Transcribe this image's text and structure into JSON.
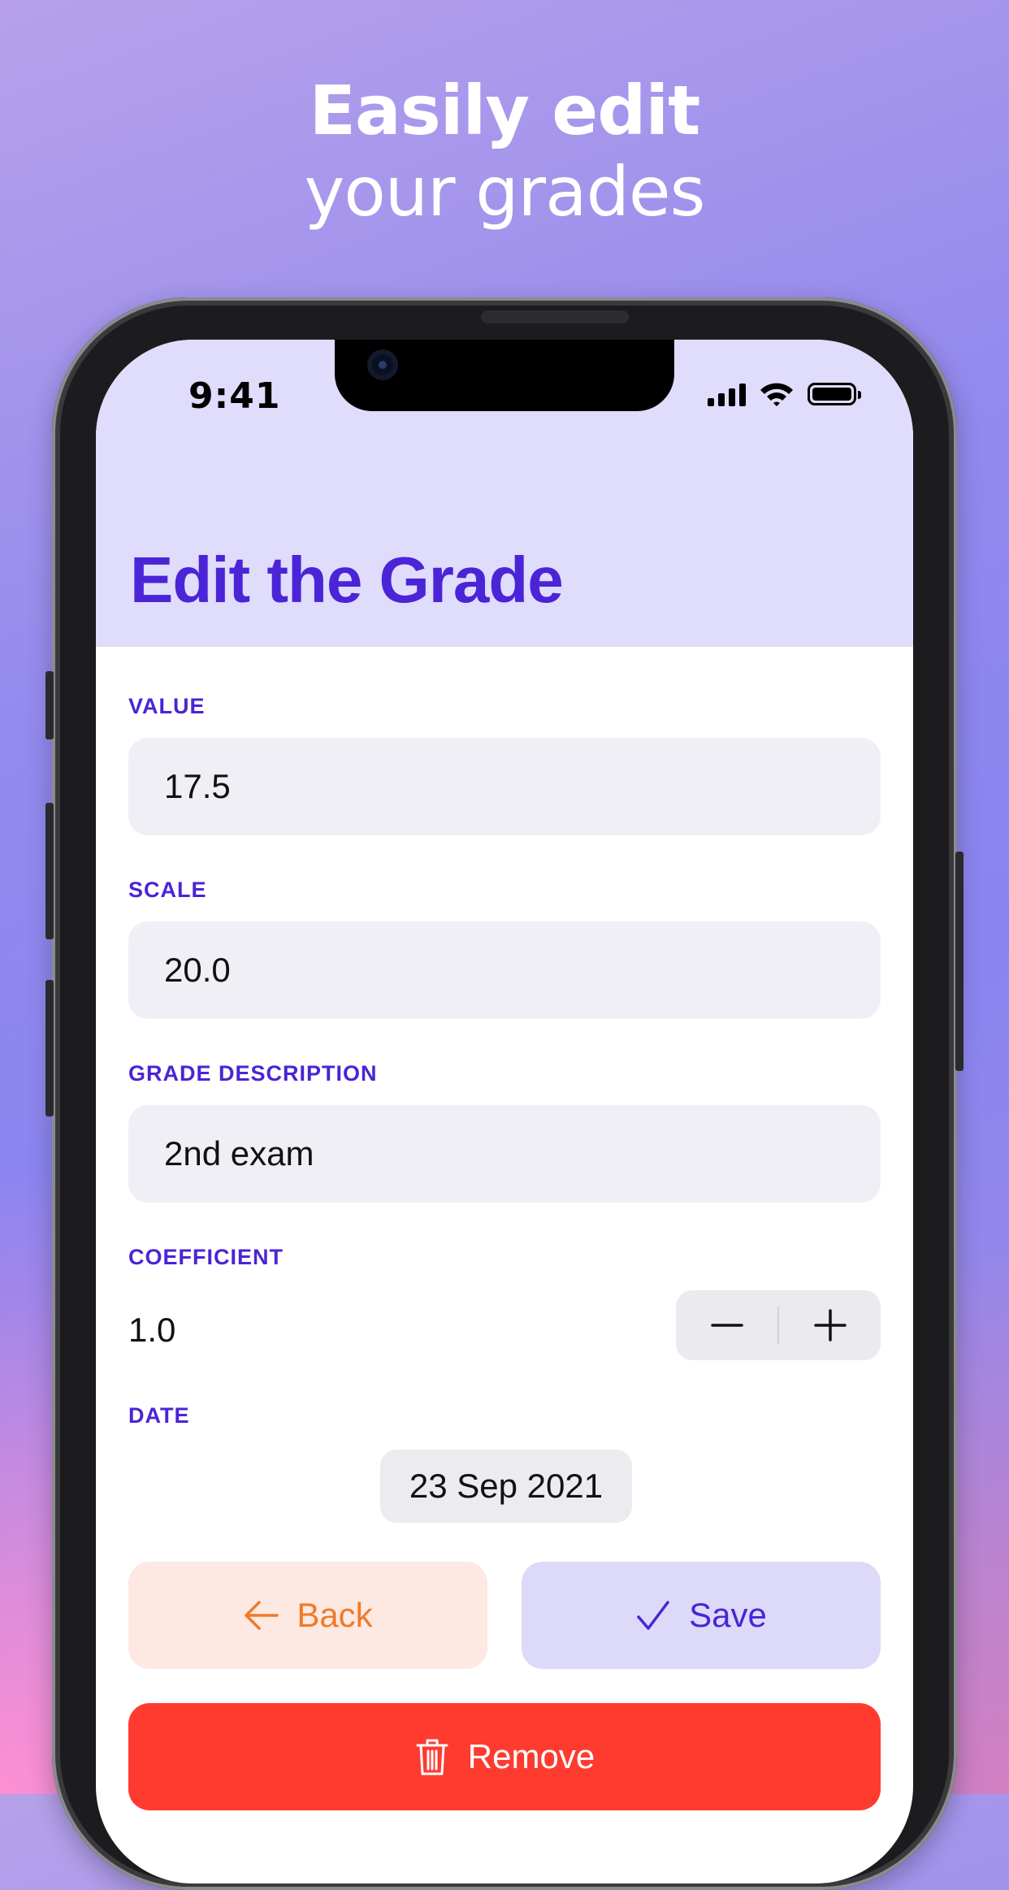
{
  "headline": {
    "line1": "Easily edit",
    "line2": "your grades"
  },
  "status_bar": {
    "time": "9:41"
  },
  "page": {
    "title": "Edit the Grade"
  },
  "form": {
    "value": {
      "label": "VALUE",
      "input": "17.5"
    },
    "scale": {
      "label": "SCALE",
      "input": "20.0"
    },
    "description": {
      "label": "GRADE DESCRIPTION",
      "input": "2nd exam"
    },
    "coefficient": {
      "label": "COEFFICIENT",
      "value": "1.0"
    },
    "date": {
      "label": "DATE",
      "value": "23 Sep 2021"
    }
  },
  "actions": {
    "back": "Back",
    "save": "Save",
    "remove": "Remove"
  },
  "colors": {
    "accent": "#4a24d6",
    "header_bg": "#e0dcfb",
    "back": "#f07a2a",
    "remove": "#ff3b30"
  },
  "icons": [
    "signal-icon",
    "wifi-icon",
    "battery-icon",
    "minus-icon",
    "plus-icon",
    "arrow-left-icon",
    "checkmark-icon",
    "trash-icon"
  ]
}
